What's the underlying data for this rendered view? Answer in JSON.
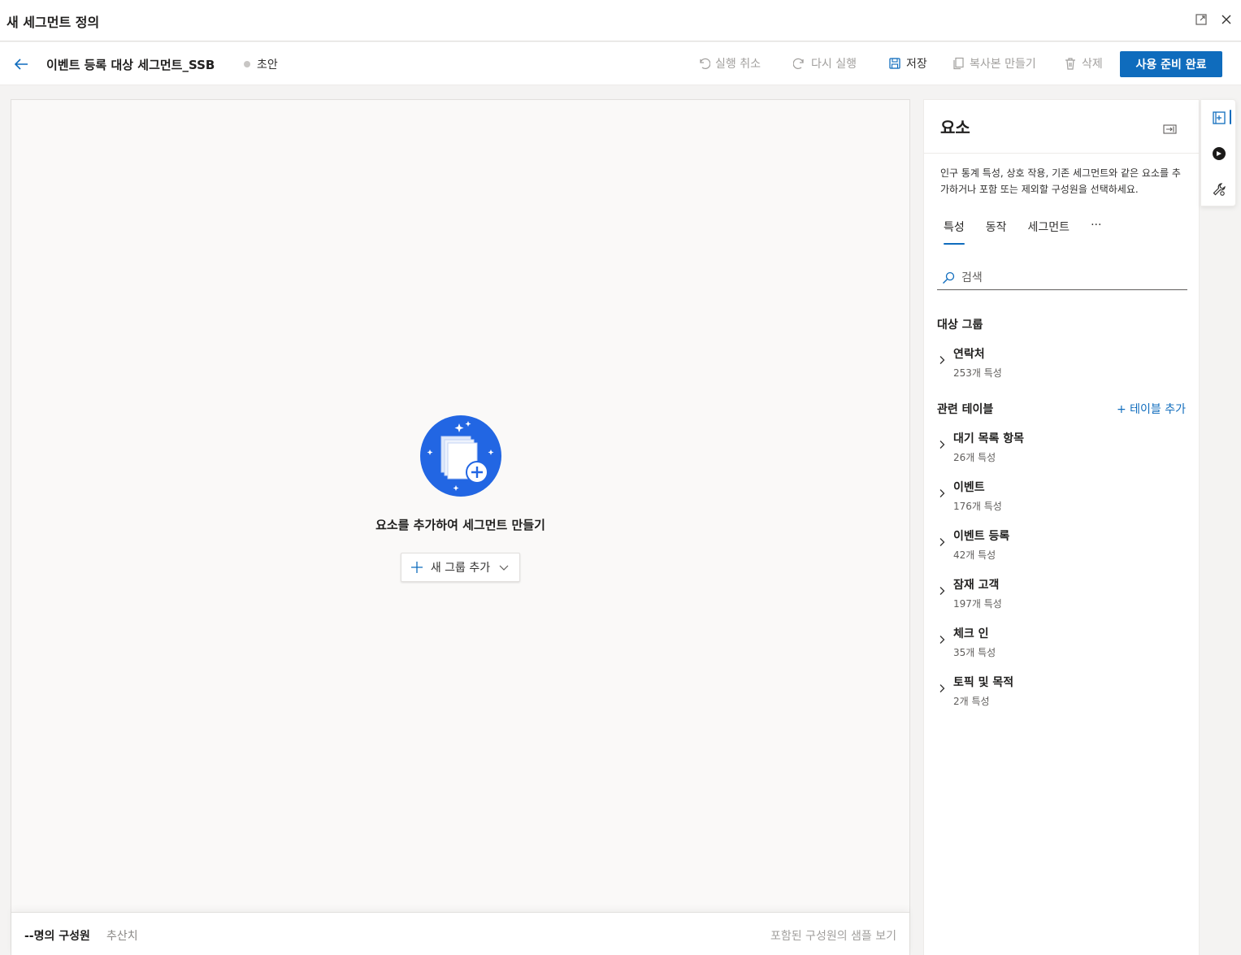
{
  "window": {
    "title": "새 세그먼트 정의"
  },
  "header": {
    "segment_name": "이벤트 등록 대상 세그먼트_SSB",
    "status": "초안",
    "undo_label": "실행 취소",
    "redo_label": "다시 실행",
    "save_label": "저장",
    "duplicate_label": "복사본 만들기",
    "delete_label": "삭제",
    "ready_label": "사용 준비 완료"
  },
  "canvas": {
    "empty_title": "요소를 추가하여 세그먼트 만들기",
    "add_group_label": "새 그룹 추가"
  },
  "footer": {
    "members": "--명의 구성원",
    "estimate": "추산치",
    "sample_link": "포함된 구성원의 샘플 보기"
  },
  "panel": {
    "title": "요소",
    "description": "인구 통계 특성, 상호 작용, 기존 세그먼트와 같은 요소를 추가하거나 포함 또는 제외할 구성원을 선택하세요.",
    "tabs": [
      {
        "label": "특성",
        "active": true
      },
      {
        "label": "동작",
        "active": false
      },
      {
        "label": "세그먼트",
        "active": false
      },
      {
        "label": "···",
        "active": false
      }
    ],
    "search_placeholder": "검색",
    "audience_section": "대상 그룹",
    "audience": [
      {
        "name": "연락처",
        "count": "253개 특성"
      }
    ],
    "related_section": "관련 테이블",
    "add_table_label": "+ 테이블 추가",
    "related": [
      {
        "name": "대기 목록 항목",
        "count": "26개 특성"
      },
      {
        "name": "이벤트",
        "count": "176개 특성"
      },
      {
        "name": "이벤트 등록",
        "count": "42개 특성"
      },
      {
        "name": "잠재 고객",
        "count": "197개 특성"
      },
      {
        "name": "체크 인",
        "count": "35개 특성"
      },
      {
        "name": "토픽 및 목적",
        "count": "2개 특성"
      }
    ]
  },
  "colors": {
    "accent": "#0f6cbd",
    "illustration": "#2266e3"
  }
}
